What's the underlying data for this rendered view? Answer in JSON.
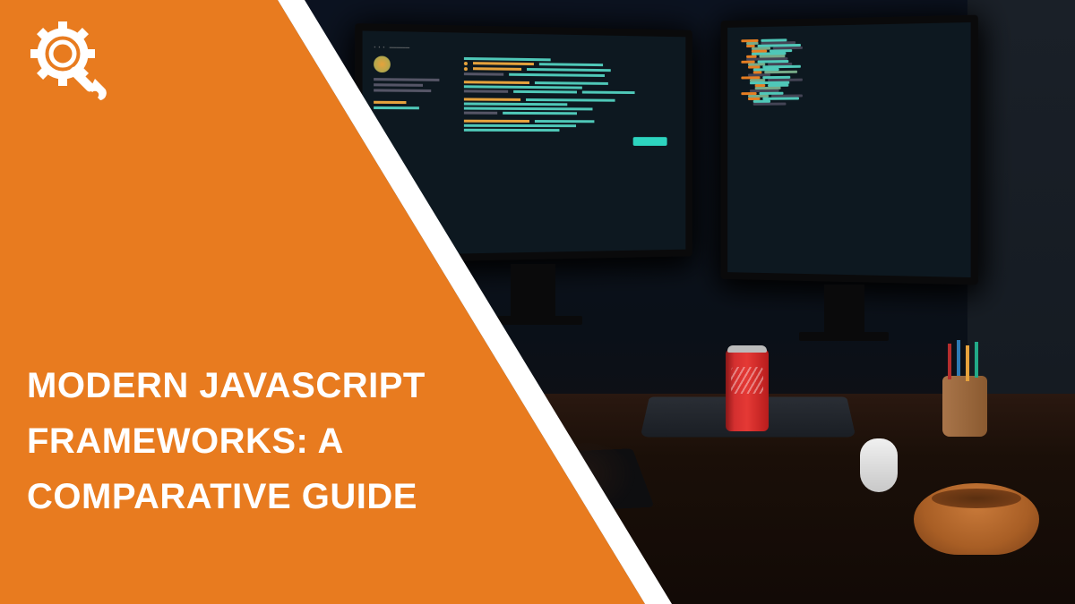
{
  "title": "MODERN JAVASCRIPT FRAMEWORKS: A COMPARATIVE GUIDE",
  "colors": {
    "accent": "#e87b1f",
    "accent_dark": "#d96b10",
    "background": "#0b1220",
    "text": "#ffffff"
  },
  "logo": {
    "name": "gear-magnifier-wrench-icon"
  },
  "scene": {
    "description": "Dark desk workspace with two monitors showing code editor UI, a laptop, keyboard, mouse, soda can, pen holder, and ceramic bowl.",
    "monitors": 2,
    "desk_items": [
      "laptop",
      "keyboard",
      "mouse",
      "soda-can",
      "pen-holder",
      "bowl"
    ]
  }
}
